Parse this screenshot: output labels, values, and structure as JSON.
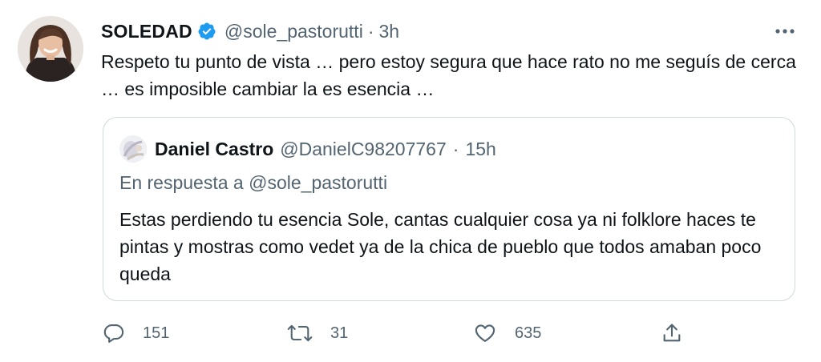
{
  "tweet": {
    "author_name": "SOLEDAD",
    "author_handle": "@sole_pastorutti",
    "separator": "·",
    "time": "3h",
    "text": "Respeto tu punto de vista … pero estoy segura que hace rato no me seguís de cerca … es imposible cambiar la es esencia …",
    "verified_icon": "verified-badge-icon",
    "more_icon": "more-options-icon",
    "colors": {
      "verified": "#1d9bf0",
      "text": "#0f1419",
      "muted": "#536471",
      "border": "#cfd9de"
    }
  },
  "quote": {
    "author_name": "Daniel Castro",
    "author_handle": "@DanielC98207767",
    "separator": "·",
    "time": "15h",
    "reply_prefix": "En respuesta a",
    "reply_to": "@sole_pastorutti",
    "text": "Estas perdiendo tu esencia Sole, cantas cualquier cosa ya ni folklore haces te pintas y mostras como vedet ya de la chica de pueblo que todos amaban poco queda"
  },
  "actions": {
    "replies": "151",
    "retweets": "31",
    "likes": "635",
    "reply_icon": "reply-icon",
    "retweet_icon": "retweet-icon",
    "like_icon": "heart-icon",
    "share_icon": "share-icon"
  }
}
